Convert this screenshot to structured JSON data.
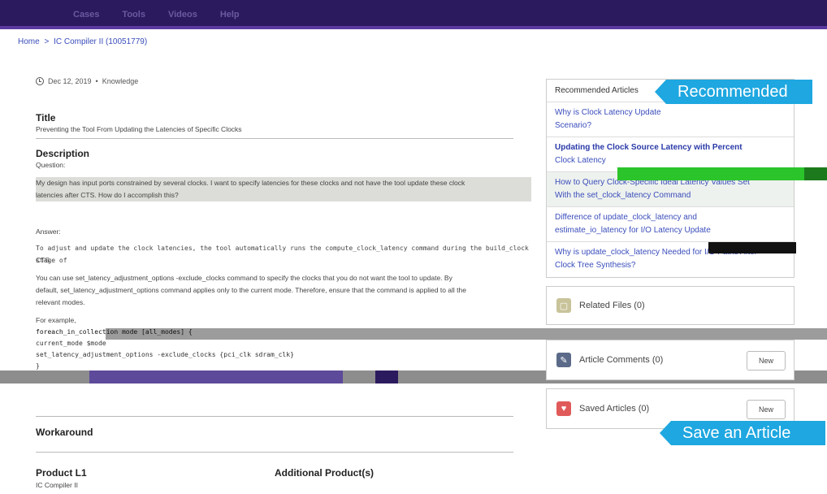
{
  "header": {
    "nav_items": [
      "Cases",
      "Tools",
      "Videos",
      "Help"
    ]
  },
  "breadcrumb": {
    "home": "Home",
    "separator": ">",
    "current": "IC Compiler II (10051779)"
  },
  "meta": {
    "date": "Dec 12, 2019",
    "dot": "•",
    "type": "Knowledge"
  },
  "article": {
    "title_heading": "Title",
    "title_text": "Preventing the Tool From Updating the Latencies of Specific Clocks",
    "description_heading": "Description",
    "question_label": "Question:",
    "question_line1": "My design has input ports constrained by several clocks. I want to specify latencies for these clocks and not have the tool update these clock",
    "question_line2": "latencies after CTS. How do I accomplish this?",
    "answer_label": "Answer:",
    "answer_p1_line1": "To adjust and update the clock latencies, the tool automatically runs the compute_clock_latency command during the build_clock stage of",
    "answer_p1_line2": "CTS.",
    "answer_p2_line1": "You can use set_latency_adjustment_options -exclude_clocks command to specify the clocks that you do not want the tool to update. By",
    "answer_p2_line2": "default, set_latency_adjustment_options command applies only to the current mode. Therefore, ensure that the command is applied to all the",
    "answer_p2_line3": "relevant modes.",
    "example_label": "For example,",
    "code_line1": "foreach_in_collection mode [all_modes] {",
    "code_line2": "  current_mode $mode",
    "code_line3": "  set_latency_adjustment_options -exclude_clocks {pci_clk sdram_clk}",
    "code_line4": "}",
    "workaround_heading": "Workaround",
    "product_heading": "Product L1",
    "product_value": "IC Compiler II",
    "additional_heading": "Additional Product(s)"
  },
  "sidebar": {
    "recommended_header": "Recommended Articles",
    "recommended_callout": "Recommended",
    "items": [
      {
        "line1": "Why is Clock Latency Update",
        "line2": "Scenario?"
      },
      {
        "line1": "Updating the Clock Source Latency with Percent",
        "line2": "Clock Latency"
      },
      {
        "line1": "How to Query Clock-Specific Ideal Latency Values Set",
        "line2": "With the set_clock_latency Command"
      },
      {
        "line1": "Difference of update_clock_latency and",
        "line2": "estimate_io_latency for I/O Latency Update"
      },
      {
        "line1": "Why is update_clock_latency Needed for I/O Paths After",
        "line2": "Clock Tree Synthesis?"
      }
    ],
    "related_files": "Related Files (0)",
    "article_comments": "Article Comments (0)",
    "saved_articles": "Saved Articles (0)",
    "new_label": "New",
    "save_callout": "Save an Article"
  },
  "colors": {
    "header_bg": "#2c1a5e",
    "link": "#3a4dbb",
    "callout": "#1ea7e0"
  }
}
